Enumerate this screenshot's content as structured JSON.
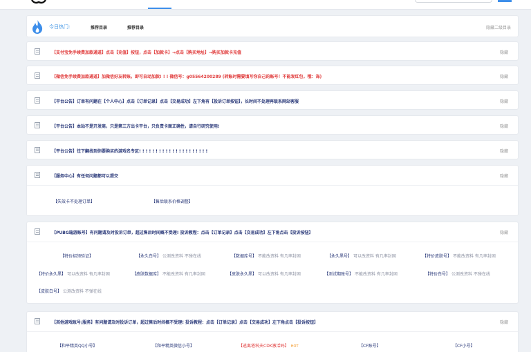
{
  "hot_bar": {
    "label": "今日热门:",
    "links": [
      "推荐目录",
      "推荐目录"
    ],
    "right_text": "隐藏二级目录"
  },
  "notices": [
    {
      "title": "【支付宝免手续费加款通道】点击【充值】按钮，点击【加款卡】→点击【购买地址】→购买加款卡充值",
      "hide": "隐藏",
      "color": "#e03a3a"
    },
    {
      "title": "【微信免手续费加款通道】加微信好友转账，即可自动加款! ! ! 微信号：g05564200289 (转账时需要填写你自己的账号！不能发红包，哦：海)",
      "hide": "隐藏",
      "color": "#e03a3a"
    },
    {
      "title": "【平台公告】订单有问题在【个人中心】点击【订单记录】点击【交易成功】左下角有【投诉订单按钮】，长时间不处理再联系网站客服",
      "hide": "隐藏",
      "color": "#2b3a7a"
    },
    {
      "title": "【平台公告】本站不是开发商，只是第三方出卡平台，只负责卡面正确性，请自行研究使用!",
      "hide": "隐藏",
      "color": "#2b3a7a"
    },
    {
      "title": "【平台公告】往下翻找到你要购买的游戏名专区! ! ! ! ! ! ! ! ! ! ! ! ! ! ! ! ! ! ! ! !",
      "hide": "隐藏",
      "color": "#2b3a7a"
    }
  ],
  "service": {
    "title": "【服务中心】有任何问题都可以提交",
    "hide": "隐藏",
    "links": [
      "【失效卡不处理订单】",
      "【售后联系价格调整】"
    ]
  },
  "pubg": {
    "title": "【PUBG端游账号】有问题请及时投诉订单，超过售后时间概不受理! 投诉教程：点击【订单记录】点击【交易成功】左下角点击【投诉按钮】",
    "hide": "隐藏",
    "items": [
      {
        "name": "【特价招领验证】",
        "note": ""
      },
      {
        "name": "【永久白号】",
        "note": "公测改资料 不弹在线"
      },
      {
        "name": "【数据库号】",
        "note": "不能改资料 有几率封固"
      },
      {
        "name": "【永久黑号】",
        "note": "可以改资料 有几率封固"
      },
      {
        "name": "【特价皮肤号】",
        "note": "不能改资料 有几率封固"
      },
      {
        "name": "【特价永久黑】",
        "note": "可以改资料 有几率封固"
      },
      {
        "name": "【皮肤数据库】",
        "note": "不能改资料 有几率封固"
      },
      {
        "name": "【皮肤永久黑】",
        "note": "可以改资料 有几率封固"
      },
      {
        "name": "【测试期账号】",
        "note": "不能改资料 有几率封固"
      },
      {
        "name": "【特价白号】",
        "note": "公测改资料 不弹在线"
      },
      {
        "name": "【皮肤白号】",
        "note": "公测改资料 不弹在线"
      }
    ]
  },
  "other": {
    "title": "【其他游戏账号/服务】有问题请及时投诉订单，超过售后时间概不受理! 投诉教程：点击【订单记录】点击【交易成功】左下角点击【投诉按钮】",
    "hide": "隐藏",
    "items": [
      {
        "name": "【和平精英QQ小号】",
        "tag": ""
      },
      {
        "name": "【和平精英微信小号】",
        "tag": ""
      },
      {
        "name": "【逃离塔科夫CDK激活码】",
        "tag": "HOT"
      },
      {
        "name": "【CF账号】",
        "tag": ""
      },
      {
        "name": "【CF小号】",
        "tag": ""
      }
    ]
  },
  "colors": {
    "accent": "#3d8eea",
    "red": "#e03a3a",
    "navy": "#2b3a7a",
    "panel": "#ffffff",
    "page": "#eef1f5"
  }
}
